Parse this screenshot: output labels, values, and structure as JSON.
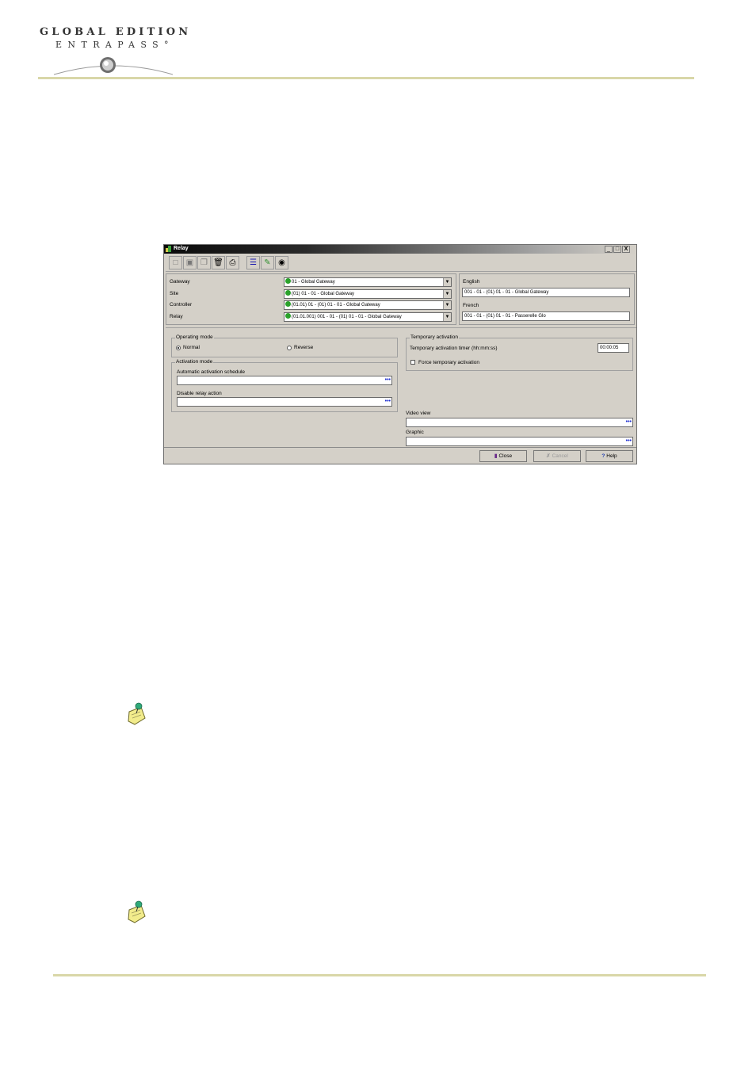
{
  "header": {
    "logo_line1": "GLOBAL EDITION",
    "logo_line2": "ENTRAPASS°"
  },
  "window": {
    "title": "Relay",
    "controls": [
      "_",
      "□",
      "X"
    ]
  },
  "toolbar": {
    "icons": [
      "new-icon",
      "save-icon",
      "copy-icon",
      "delete-icon",
      "print-icon",
      "list-icon",
      "edit-icon",
      "find-icon"
    ]
  },
  "selectors": {
    "gateway": {
      "label": "Gateway",
      "value": "01 - Global Gateway"
    },
    "site": {
      "label": "Site",
      "value": "(01) 01 - 01 - Global Gateway"
    },
    "controller": {
      "label": "Controller",
      "value": "(01.01) 01 - (01) 01 - 01 - Global Gateway"
    },
    "relay": {
      "label": "Relay",
      "value": "(01.01.001) 001 - 01 - (01) 01 - 01 - Global Gateway"
    }
  },
  "names": {
    "english": {
      "label": "English",
      "value": "001 - 01 - (01) 01 - 01 - Global Gateway"
    },
    "french": {
      "label": "French",
      "value": "001 - 01 - (01) 01 - 01 - Passerelle Glo"
    }
  },
  "operating_mode": {
    "title": "Operating mode",
    "normal": "Normal",
    "reverse": "Reverse",
    "selected": "Normal"
  },
  "activation_mode": {
    "title": "Activation mode",
    "schedule_label": "Automatic activation schedule",
    "disable_label": "Disable relay action"
  },
  "temporary_activation": {
    "title": "Temporary activation",
    "timer_label": "Temporary activation timer (hh:mm:ss)",
    "timer_value": "00:00:05",
    "force_label": "Force temporary activation"
  },
  "video_view_label": "Video view",
  "graphic_label": "Graphic",
  "browse_glyph": "•••",
  "buttons": {
    "close": "Close",
    "cancel": "Cancel",
    "help": "Help"
  }
}
